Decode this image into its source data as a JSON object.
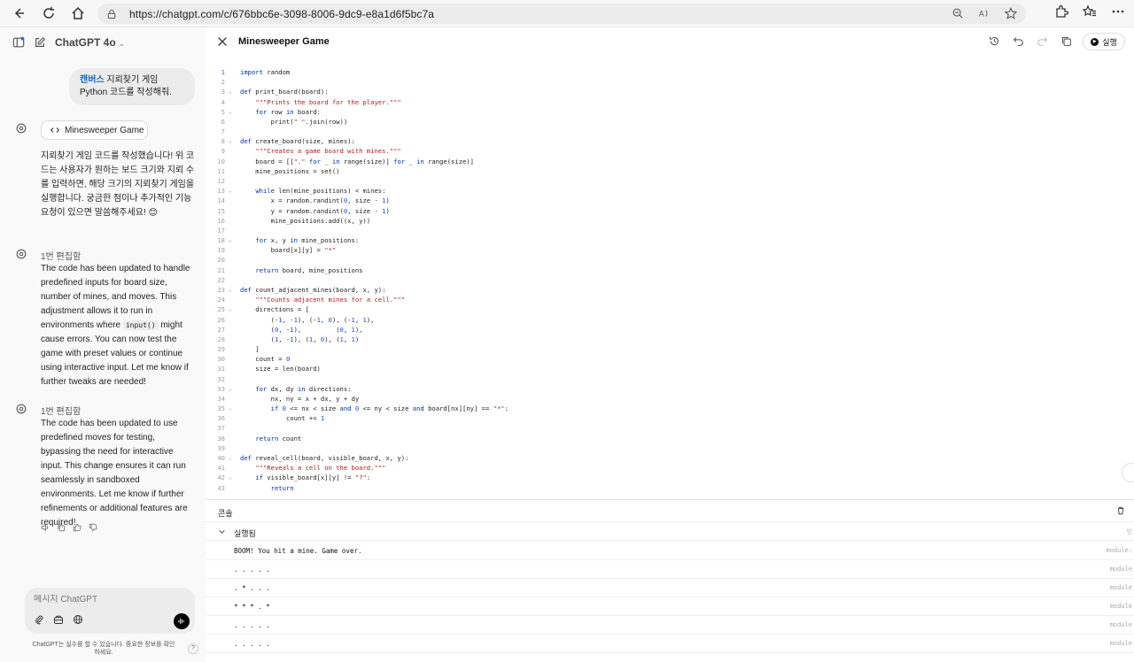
{
  "browser": {
    "url": "https://chatgpt.com/c/676bbc6e-3098-8006-9dc9-e8a1d6f5bc7a"
  },
  "sidebar": {
    "model": "ChatGPT 4o",
    "user_message_keyword": "캔버스",
    "user_message_rest": " 지뢰찾기 게임 Python 코드를 작성해줘.",
    "canvas_chip": "Minesweeper Game",
    "reply_1": "지뢰찾기 게임 코드를 작성했습니다! 위 코드는 사용자가 원하는 보드 크기와 지뢰 수를 입력하면, 해당 크기의 지뢰찾기 게임을 실행합니다. 궁금한 점이나 추가적인 기능 요청이 있으면 말씀해주세요! 😊",
    "edit_label_1": "1번 편집함",
    "reply_2_a": "The code has been updated to handle predefined inputs for board size, number of mines, and moves. This adjustment allows it to run in environments where ",
    "reply_2_code": "input()",
    "reply_2_b": " might cause errors. You can now test the game with preset values or continue using interactive input. Let me know if further tweaks are needed!",
    "edit_label_2": "1번 편집함",
    "reply_3": "The code has been updated to use predefined moves for testing, bypassing the need for interactive input. This change ensures it can run seamlessly in sandboxed environments. Let me know if further refinements or additional features are required!",
    "composer_placeholder": "메시지 ChatGPT",
    "disclaimer": "ChatGPT는 실수를 할 수 있습니다. 중요한 정보를 확인하세요.",
    "help": "?"
  },
  "canvas": {
    "title": "Minesweeper Game",
    "run_label": "실행",
    "code_lines": [
      {
        "n": "1",
        "t": "import random",
        "fold": false
      },
      {
        "n": "2",
        "t": "",
        "fold": false
      },
      {
        "n": "3",
        "t": "def print_board(board):",
        "fold": true
      },
      {
        "n": "4",
        "t": "    \"\"\"Prints the board for the player.\"\"\"",
        "fold": false
      },
      {
        "n": "5",
        "t": "    for row in board:",
        "fold": true
      },
      {
        "n": "6",
        "t": "        print(\" \".join(row))",
        "fold": false
      },
      {
        "n": "7",
        "t": "",
        "fold": false
      },
      {
        "n": "8",
        "t": "def create_board(size, mines):",
        "fold": true
      },
      {
        "n": "9",
        "t": "    \"\"\"Creates a game board with mines.\"\"\"",
        "fold": false
      },
      {
        "n": "10",
        "t": "    board = [[\".\" for _ in range(size)] for _ in range(size)]",
        "fold": false
      },
      {
        "n": "11",
        "t": "    mine_positions = set()",
        "fold": false
      },
      {
        "n": "12",
        "t": "",
        "fold": false
      },
      {
        "n": "13",
        "t": "    while len(mine_positions) < mines:",
        "fold": true
      },
      {
        "n": "14",
        "t": "        x = random.randint(0, size - 1)",
        "fold": false
      },
      {
        "n": "15",
        "t": "        y = random.randint(0, size - 1)",
        "fold": false
      },
      {
        "n": "16",
        "t": "        mine_positions.add((x, y))",
        "fold": false
      },
      {
        "n": "17",
        "t": "",
        "fold": false
      },
      {
        "n": "18",
        "t": "    for x, y in mine_positions:",
        "fold": true
      },
      {
        "n": "19",
        "t": "        board[x][y] = \"*\"",
        "fold": false
      },
      {
        "n": "20",
        "t": "",
        "fold": false
      },
      {
        "n": "21",
        "t": "    return board, mine_positions",
        "fold": false
      },
      {
        "n": "22",
        "t": "",
        "fold": false
      },
      {
        "n": "23",
        "t": "def count_adjacent_mines(board, x, y):",
        "fold": true
      },
      {
        "n": "24",
        "t": "    \"\"\"Counts adjacent mines for a cell.\"\"\"",
        "fold": false
      },
      {
        "n": "25",
        "t": "    directions = [",
        "fold": true
      },
      {
        "n": "26",
        "t": "        (-1, -1), (-1, 0), (-1, 1),",
        "fold": false
      },
      {
        "n": "27",
        "t": "        (0, -1),         (0, 1),",
        "fold": false
      },
      {
        "n": "28",
        "t": "        (1, -1), (1, 0), (1, 1)",
        "fold": false
      },
      {
        "n": "29",
        "t": "    ]",
        "fold": false
      },
      {
        "n": "30",
        "t": "    count = 0",
        "fold": false
      },
      {
        "n": "31",
        "t": "    size = len(board)",
        "fold": false
      },
      {
        "n": "32",
        "t": "",
        "fold": false
      },
      {
        "n": "33",
        "t": "    for dx, dy in directions:",
        "fold": true
      },
      {
        "n": "34",
        "t": "        nx, ny = x + dx, y + dy",
        "fold": false
      },
      {
        "n": "35",
        "t": "        if 0 <= nx < size and 0 <= ny < size and board[nx][ny] == \"*\":",
        "fold": true
      },
      {
        "n": "36",
        "t": "            count += 1",
        "fold": false
      },
      {
        "n": "37",
        "t": "",
        "fold": false
      },
      {
        "n": "38",
        "t": "    return count",
        "fold": false
      },
      {
        "n": "39",
        "t": "",
        "fold": false
      },
      {
        "n": "40",
        "t": "def reveal_cell(board, visible_board, x, y):",
        "fold": true
      },
      {
        "n": "41",
        "t": "    \"\"\"Reveals a cell on the board.\"\"\"",
        "fold": false
      },
      {
        "n": "42",
        "t": "    if visible_board[x][y] != \"?\":",
        "fold": true
      },
      {
        "n": "43",
        "t": "        return",
        "fold": false
      }
    ]
  },
  "console": {
    "title": "콘솔",
    "run_status": "실행됨",
    "run_time": "방",
    "outputs": [
      {
        "text": "BOOM! You hit a mine. Game over.",
        "module": "module:"
      },
      {
        "text": ". . . . .",
        "module": "module"
      },
      {
        "text": ". * . . .",
        "module": "module"
      },
      {
        "text": "* * * . *",
        "module": "module"
      },
      {
        "text": ". . . . .",
        "module": "module"
      },
      {
        "text": ". . . . .",
        "module": "module"
      }
    ]
  }
}
